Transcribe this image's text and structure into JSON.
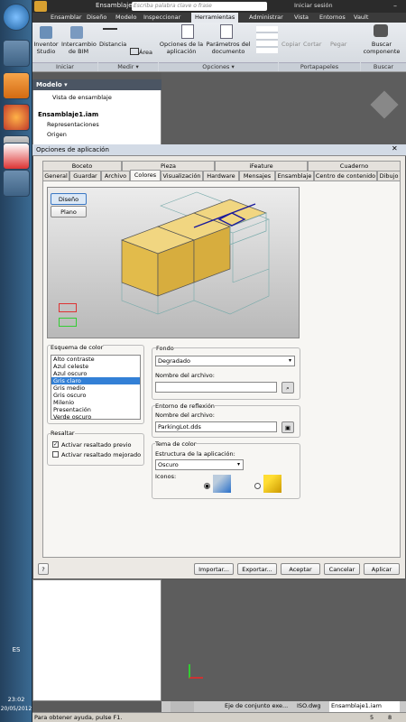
{
  "taskbar": {
    "lang": "ES",
    "time": "23:02",
    "date": "20/05/2012"
  },
  "app": {
    "title": "Ensamblaje1",
    "search_placeholder": "Escriba palabra clave o frase",
    "signin": "Iniciar sesión",
    "tabs": [
      "Ensamblar",
      "Diseño",
      "Modelo",
      "Inspeccionar",
      "Herramientas",
      "Administrar",
      "Vista",
      "Entornos",
      "Vault"
    ],
    "ribbon": {
      "inventor_studio": "Inventor Studio",
      "bim": "Intercambio de BIM",
      "group_iniciar": "Iniciar",
      "distancia": "Distancia",
      "area": "Área",
      "group_medir": "Medir ▾",
      "opciones_app": "Opciones de la aplicación",
      "parametros_doc": "Parámetros del documento",
      "group_opciones": "Opciones ▾",
      "copiar": "Copiar",
      "cortar": "Cortar",
      "pegar": "Pegar",
      "group_portapapeles": "Portapapeles",
      "buscar_componente": "Buscar componente",
      "group_buscar": "Buscar"
    }
  },
  "browser": {
    "title": "Modelo ▾",
    "view": "Vista de ensamblaje",
    "items": [
      "Ensamblaje1.iam",
      "Representaciones",
      "Origen"
    ]
  },
  "dialog": {
    "title": "Opciones de aplicación",
    "tabs_row1": [
      "Boceto",
      "Pieza",
      "iFeature",
      "Cuaderno"
    ],
    "tabs_row2": [
      "General",
      "Guardar",
      "Archivo",
      "Colores",
      "Visualización",
      "Hardware",
      "Mensajes",
      "Ensamblaje",
      "Centro de contenido",
      "Dibujo"
    ],
    "preview_buttons": [
      "Diseño",
      "Plano"
    ],
    "esquema_label": "Esquema de color",
    "esquema_items": [
      "Alto contraste",
      "Azul celeste",
      "Azul oscuro",
      "Gris claro",
      "Gris medio",
      "Gris oscuro",
      "Milenio",
      "Presentación",
      "Verde oscuro"
    ],
    "selected_scheme": "Gris claro",
    "fondo_label": "Fondo",
    "fondo_value": "Degradado",
    "archivo_label": "Nombre del archivo:",
    "archivo_value": "",
    "entorno_label": "Entorno de reflexión",
    "entorno_archivo_label": "Nombre del archivo:",
    "entorno_archivo_value": "ParkingLot.dds",
    "resaltar_label": "Resaltar",
    "resaltar_previo": "Activar resaltado previo",
    "resaltar_mejorado": "Activar resaltado mejorado",
    "tema_label": "Tema de color",
    "estructura_label": "Estructura de la aplicación:",
    "estructura_value": "Oscuro",
    "iconos_label": "Iconos:",
    "buttons": {
      "importar": "Importar...",
      "exportar": "Exportar...",
      "aceptar": "Aceptar",
      "cancelar": "Cancelar",
      "aplicar": "Aplicar"
    },
    "colors": {
      "box": "#e8c65a",
      "highlight": "#1a1a9c"
    }
  },
  "doc_tabs": [
    "Eje de conjunto exe...",
    "ISO.dwg",
    "Ensamblaje1.iam"
  ],
  "status": {
    "help": "Para obtener ayuda, pulse F1.",
    "n1": "5",
    "n2": "8"
  }
}
